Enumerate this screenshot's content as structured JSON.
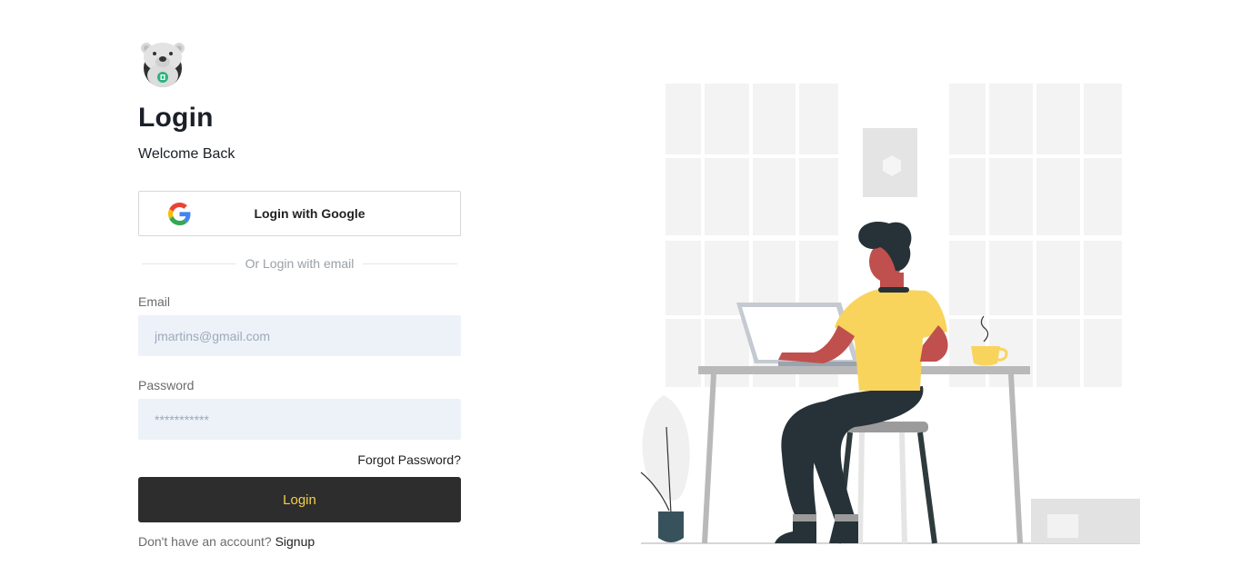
{
  "header": {
    "logo_icon": "bear-mascot-logo",
    "title": "Login",
    "subtitle": "Welcome Back"
  },
  "google_login": {
    "icon": "google-icon",
    "label": "Login with Google"
  },
  "divider": {
    "text": "Or Login with email"
  },
  "form": {
    "email_label": "Email",
    "email_placeholder": "jmartins@gmail.com",
    "password_label": "Password",
    "password_placeholder": "***********",
    "forgot_label": "Forgot Password?",
    "submit_label": "Login"
  },
  "footer": {
    "prompt": "Don't have an account?",
    "signup_label": "Signup"
  },
  "colors": {
    "button_bg": "#2d2d2d",
    "button_text": "#f5cf45",
    "input_bg": "#edf2f9",
    "illustration_accent": "#f9d45c"
  },
  "illustration": {
    "icon": "person-working-at-laptop-illustration"
  }
}
